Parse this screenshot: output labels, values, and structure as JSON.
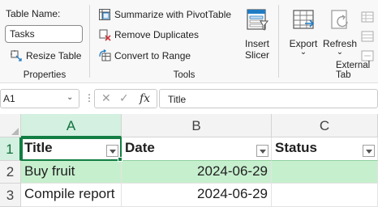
{
  "ribbon": {
    "properties": {
      "table_name_label": "Table Name:",
      "table_name_value": "Tasks",
      "resize_label": "Resize Table",
      "group_label": "Properties"
    },
    "tools": {
      "summarize_label": "Summarize with PivotTable",
      "remove_dup_label": "Remove Duplicates",
      "convert_label": "Convert to Range",
      "insert_slicer_line1": "Insert",
      "insert_slicer_line2": "Slicer",
      "group_label": "Tools"
    },
    "external": {
      "export_label": "Export",
      "export_chevron": "⌄",
      "refresh_label": "Refresh",
      "refresh_chevron": "⌄",
      "group_label": "External Tab"
    }
  },
  "formula_bar": {
    "name_box": "A1",
    "name_box_chevron": "⌄",
    "dots": "⋮",
    "cancel_glyph": "✕",
    "enter_glyph": "✓",
    "fx_glyph": "fx",
    "formula": "Title"
  },
  "grid": {
    "columns": [
      "A",
      "B",
      "C"
    ],
    "rows": [
      "1",
      "2",
      "3"
    ],
    "header": [
      "Title",
      "Date",
      "Status"
    ],
    "data": [
      [
        "Buy fruit",
        "2024-06-29",
        ""
      ],
      [
        "Compile report",
        "2024-06-29",
        ""
      ]
    ]
  },
  "colors": {
    "accent": "#137e43",
    "banded_row": "#c6efce"
  }
}
